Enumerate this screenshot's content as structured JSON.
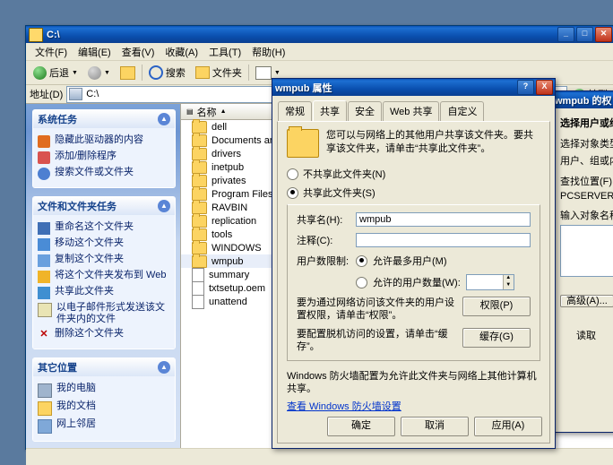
{
  "explorer": {
    "title": "C:\\",
    "window_buttons": [
      "minimize",
      "maximize",
      "close"
    ],
    "menus": [
      "文件(F)",
      "编辑(E)",
      "查看(V)",
      "收藏(A)",
      "工具(T)",
      "帮助(H)"
    ],
    "toolbar": {
      "back": "后退",
      "forward": "",
      "up": "",
      "search": "搜索",
      "folders": "文件夹",
      "views": ""
    },
    "address": {
      "label": "地址(D)",
      "value": "C:\\",
      "go": "转到"
    },
    "task_panels": [
      {
        "title": "系统任务",
        "items": [
          "隐藏此驱动器的内容",
          "添加/删除程序",
          "搜索文件或文件夹"
        ]
      },
      {
        "title": "文件和文件夹任务",
        "items": [
          "重命名这个文件夹",
          "移动这个文件夹",
          "复制这个文件夹",
          "将这个文件夹发布到 Web",
          "共享此文件夹",
          "以电子邮件形式发送该文件夹内的文件",
          "删除这个文件夹"
        ]
      },
      {
        "title": "其它位置",
        "items": [
          "我的电脑",
          "我的文档",
          "网上邻居"
        ]
      }
    ],
    "list_header": "名称",
    "files": [
      {
        "name": "dell",
        "type": "folder",
        "selected": false
      },
      {
        "name": "Documents and S",
        "type": "folder",
        "selected": false
      },
      {
        "name": "drivers",
        "type": "folder",
        "selected": false
      },
      {
        "name": "inetpub",
        "type": "folder",
        "selected": false
      },
      {
        "name": "privates",
        "type": "folder",
        "selected": false
      },
      {
        "name": "Program Files",
        "type": "folder",
        "selected": false
      },
      {
        "name": "RAVBIN",
        "type": "folder",
        "selected": false
      },
      {
        "name": "replication",
        "type": "folder",
        "selected": false
      },
      {
        "name": "tools",
        "type": "folder",
        "selected": false
      },
      {
        "name": "WINDOWS",
        "type": "folder",
        "selected": false
      },
      {
        "name": "wmpub",
        "type": "folder",
        "selected": true
      },
      {
        "name": "summary",
        "type": "file",
        "selected": false
      },
      {
        "name": "txtsetup.oem",
        "type": "file",
        "selected": false
      },
      {
        "name": "unattend",
        "type": "file",
        "selected": false
      }
    ]
  },
  "properties": {
    "title": "wmpub 属性",
    "help_button": "?",
    "close_button": "X",
    "tabs": [
      {
        "label": "常规",
        "active": false
      },
      {
        "label": "共享",
        "active": true
      },
      {
        "label": "安全",
        "active": false
      },
      {
        "label": "Web 共享",
        "active": false
      },
      {
        "label": "自定义",
        "active": false
      }
    ],
    "intro": "您可以与网络上的其他用户共享该文件夹。要共享该文件夹，请单击“共享此文件夹”。",
    "radio_not_share": "不共享此文件夹(N)",
    "radio_share": "共享此文件夹(S)",
    "group_title": "共享此文件夹(S)",
    "share_name_label": "共享名(H):",
    "share_name_value": "wmpub",
    "comment_label": "注释(C):",
    "comment_value": "",
    "user_limit_label": "用户数限制:",
    "radio_max_users": "允许最多用户(M)",
    "radio_allow_users": "允许的用户数量(W):",
    "user_count_value": "",
    "perm_text": "要为通过网络访问该文件夹的用户设置权限，请单击“权限”。",
    "perm_button": "权限(P)",
    "cache_text": "要配置脱机访问的设置，请单击“缓存”。",
    "cache_button": "缓存(G)",
    "firewall_text": "Windows 防火墙配置为允许此文件夹与网络上其他计算机共享。",
    "firewall_link": "查看 Windows 防火墙设置",
    "ok_button": "确定",
    "cancel_button": "取消",
    "apply_button": "应用(A)"
  },
  "select_users": {
    "title": "wmpub 的权",
    "heading": "选择用户或组",
    "object_type_label": "选择对象类型(S):",
    "object_type_value": "用户、组或内",
    "location_label": "查找位置(F):",
    "location_value": "PCSERVER",
    "names_label": "输入对象名称",
    "names_value": "",
    "advanced_button": "高级(A)...",
    "permissions_header": "读取"
  }
}
